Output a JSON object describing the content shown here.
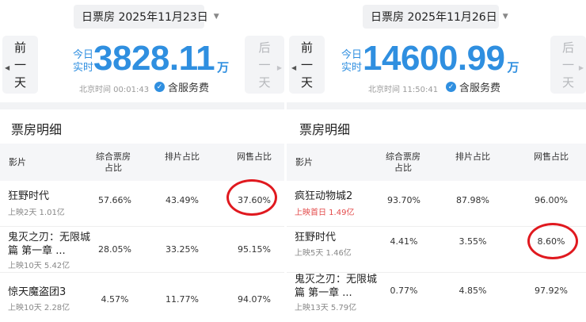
{
  "columns": [
    "影片",
    "综合票房占比",
    "排片占比",
    "网售占比"
  ],
  "left": {
    "date_label": "日票房 2025年11月23日",
    "prev_day": [
      "前",
      "一",
      "天"
    ],
    "next_day": [
      "后",
      "一",
      "天"
    ],
    "today_label": [
      "今日",
      "实时"
    ],
    "total": "3828.11",
    "unit": "万",
    "clock": "北京时间 00:01:43",
    "fee": "含服务费",
    "section_title": "票房明细",
    "rows": [
      {
        "name": "狂野时代",
        "sub": "上映2天 1.01亿",
        "box": "57.66%",
        "screen": "43.49%",
        "online": "37.60%"
      },
      {
        "name": "鬼灭之刃：无限城篇 第一章 ...",
        "sub": "上映10天 5.42亿",
        "box": "28.05%",
        "screen": "33.25%",
        "online": "95.15%"
      },
      {
        "name": "惊天魔盗团3",
        "sub": "上映10天 2.28亿",
        "box": "4.57%",
        "screen": "11.77%",
        "online": "94.07%"
      }
    ]
  },
  "right": {
    "date_label": "日票房 2025年11月26日",
    "prev_day": [
      "前",
      "一",
      "天"
    ],
    "next_day": [
      "后",
      "一",
      "天"
    ],
    "today_label": [
      "今日",
      "实时"
    ],
    "total": "14600.99",
    "unit": "万",
    "clock": "北京时间 11:50:41",
    "fee": "含服务费",
    "section_title": "票房明细",
    "rows": [
      {
        "name": "疯狂动物城2",
        "sub": "上映首日 1.49亿",
        "hot": true,
        "box": "93.70%",
        "screen": "87.98%",
        "online": "96.00%"
      },
      {
        "name": "狂野时代",
        "sub": "上映5天 1.46亿",
        "box": "4.41%",
        "screen": "3.55%",
        "online": "8.60%"
      },
      {
        "name": "鬼灭之刃：无限城篇 第一章 ...",
        "sub": "上映13天 5.79亿",
        "box": "0.77%",
        "screen": "4.85%",
        "online": "97.92%"
      }
    ]
  },
  "colors": {
    "accent": "#2f8fe0",
    "highlight": "#e0191f",
    "hot": "#e34a4a"
  }
}
